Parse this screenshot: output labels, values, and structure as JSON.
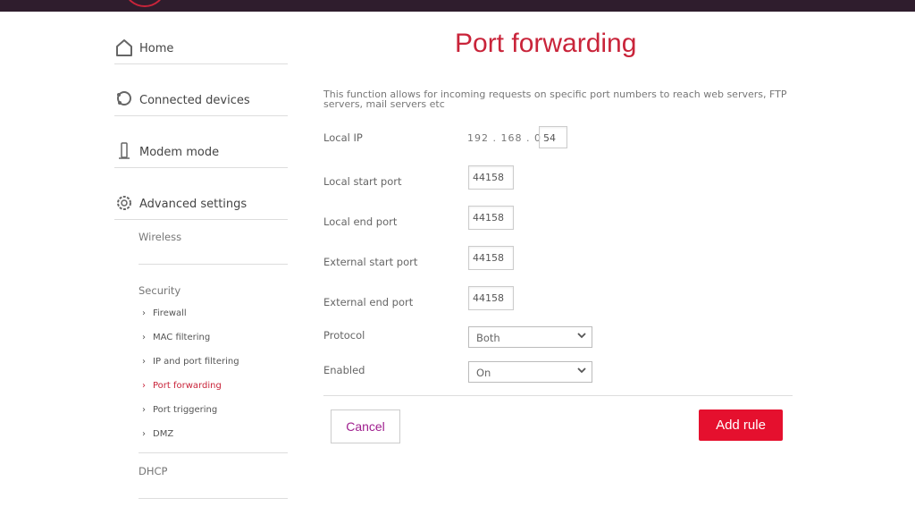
{
  "nav": {
    "items": [
      {
        "label": "Home",
        "icon": "home-icon"
      },
      {
        "label": "Connected devices",
        "icon": "devices-icon"
      },
      {
        "label": "Modem mode",
        "icon": "modem-icon"
      },
      {
        "label": "Advanced settings",
        "icon": "gear-icon"
      }
    ],
    "sub": {
      "wireless": "Wireless",
      "security": "Security",
      "security_items": [
        "Firewall",
        "MAC filtering",
        "IP and port filtering",
        "Port forwarding",
        "Port triggering",
        "DMZ"
      ],
      "active": "Port forwarding",
      "dhcp": "DHCP"
    }
  },
  "main": {
    "title": "Port forwarding",
    "description": "This function allows for incoming requests on specific port numbers to reach web servers, FTP servers, mail servers etc",
    "local_ip_label": "Local IP",
    "ip_prefix": "192 . 168 . 0 .",
    "ip_last": "54",
    "local_start_label": "Local start port",
    "local_start": "44158",
    "local_end_label": "Local end port",
    "local_end": "44158",
    "ext_start_label": "External start port",
    "ext_start": "44158",
    "ext_end_label": "External end port",
    "ext_end": "44158",
    "protocol_label": "Protocol",
    "protocol": "Both",
    "enabled_label": "Enabled",
    "enabled": "On",
    "cancel": "Cancel",
    "add": "Add rule"
  },
  "colors": {
    "accent": "#c9243a",
    "button": "#e5102e",
    "topbar": "#2f1d2d",
    "cancel_text": "#a0208f"
  }
}
